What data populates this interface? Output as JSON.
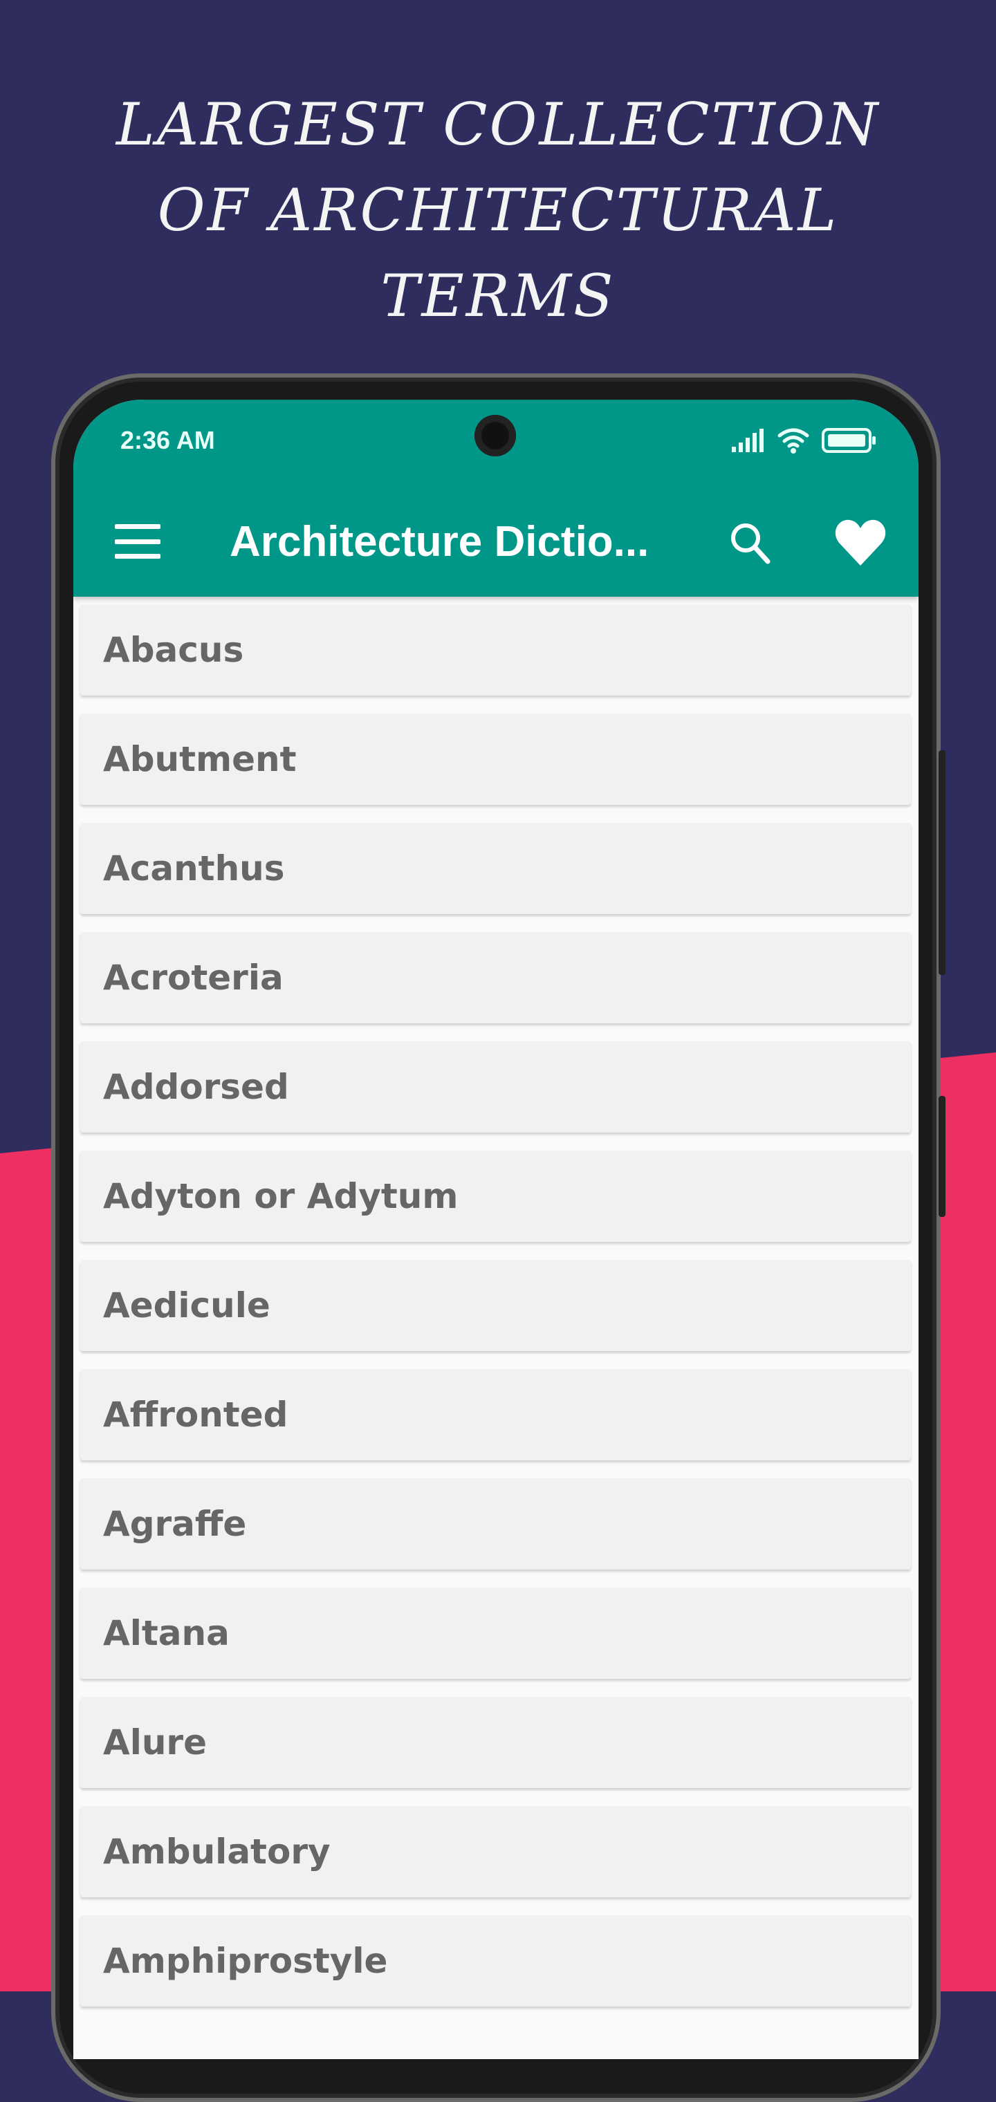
{
  "promo": {
    "headline_lines": [
      "LARGEST COLLECTION",
      "OF ARCHITECTURAL",
      "TERMS"
    ]
  },
  "colors": {
    "navy": "#2e2d5e",
    "pink": "#ee2f62",
    "appbar": "#009688"
  },
  "status_bar": {
    "time": "2:36 AM",
    "icons": [
      "signal-icon",
      "wifi-icon",
      "battery-icon"
    ]
  },
  "toolbar": {
    "title": "Architecture Dictio...",
    "icons": [
      "menu-icon",
      "search-icon",
      "heart-icon"
    ]
  },
  "terms": [
    "Abacus",
    "Abutment",
    "Acanthus",
    "Acroteria",
    "Addorsed",
    "Adyton or Adytum",
    "Aedicule",
    "Affronted",
    "Agraffe",
    "Altana",
    "Alure",
    "Ambulatory",
    "Amphiprostyle"
  ]
}
